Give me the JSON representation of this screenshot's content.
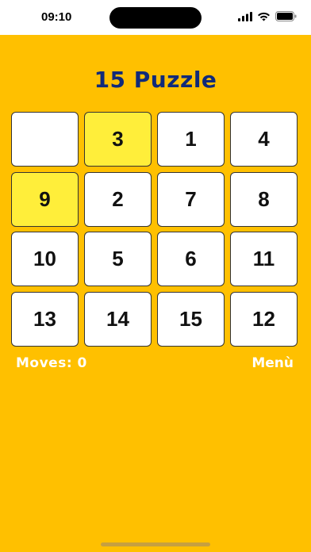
{
  "status_bar": {
    "time": "09:10",
    "icons": [
      "signal-icon",
      "wifi-icon",
      "battery-icon"
    ]
  },
  "title": "15 Puzzle",
  "board": {
    "tiles": [
      {
        "label": "",
        "state": "empty"
      },
      {
        "label": "3",
        "state": "correct"
      },
      {
        "label": "1",
        "state": "normal"
      },
      {
        "label": "4",
        "state": "normal"
      },
      {
        "label": "9",
        "state": "correct"
      },
      {
        "label": "2",
        "state": "normal"
      },
      {
        "label": "7",
        "state": "normal"
      },
      {
        "label": "8",
        "state": "normal"
      },
      {
        "label": "10",
        "state": "normal"
      },
      {
        "label": "5",
        "state": "normal"
      },
      {
        "label": "6",
        "state": "normal"
      },
      {
        "label": "11",
        "state": "normal"
      },
      {
        "label": "13",
        "state": "normal"
      },
      {
        "label": "14",
        "state": "normal"
      },
      {
        "label": "15",
        "state": "normal"
      },
      {
        "label": "12",
        "state": "normal"
      }
    ]
  },
  "footer": {
    "moves_label": "Moves: 0",
    "menu_label": "Menù"
  },
  "colors": {
    "background": "#FFC000",
    "title": "#102A7A",
    "highlight_tile": "#FFEE3A",
    "tile": "#FFFFFF"
  }
}
